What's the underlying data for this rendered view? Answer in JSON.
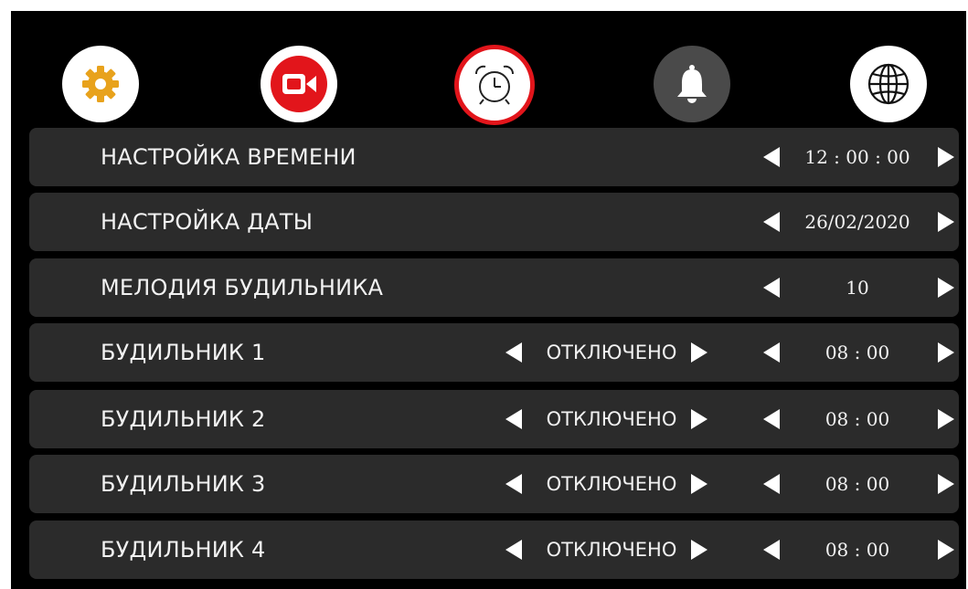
{
  "toolbar": {
    "tabs": [
      {
        "icon": "gear-icon",
        "selected": false,
        "color": "#e8a21c"
      },
      {
        "icon": "video-camera-icon",
        "selected": false,
        "color": "#e2151b"
      },
      {
        "icon": "alarm-clock-icon",
        "selected": true,
        "color": "#e2151b"
      },
      {
        "icon": "bell-icon",
        "selected": false,
        "color": "#4a4a4a"
      },
      {
        "icon": "globe-icon",
        "selected": false,
        "color": "#ffffff"
      }
    ]
  },
  "settings": {
    "time": {
      "label": "НАСТРОЙКА ВРЕМЕНИ",
      "value": "12 : 00 : 00"
    },
    "date": {
      "label": "НАСТРОЙКА ДАТЫ",
      "value": "26/02/2020"
    },
    "melody": {
      "label": "МЕЛОДИЯ БУДИЛЬНИКА",
      "value": "10"
    },
    "alarms": [
      {
        "label": "БУДИЛЬНИК 1",
        "state": "ОТКЛЮЧЕНО",
        "time": "08 : 00"
      },
      {
        "label": "БУДИЛЬНИК 2",
        "state": "ОТКЛЮЧЕНО",
        "time": "08 : 00"
      },
      {
        "label": "БУДИЛЬНИК 3",
        "state": "ОТКЛЮЧЕНО",
        "time": "08 : 00"
      },
      {
        "label": "БУДИЛЬНИК 4",
        "state": "ОТКЛЮЧЕНО",
        "time": "08 : 00"
      }
    ]
  },
  "colors": {
    "background": "#000000",
    "row": "#2b2b2b",
    "accent_red": "#e2151b",
    "gear_orange": "#e8a21c",
    "text": "#f2f2f2"
  }
}
